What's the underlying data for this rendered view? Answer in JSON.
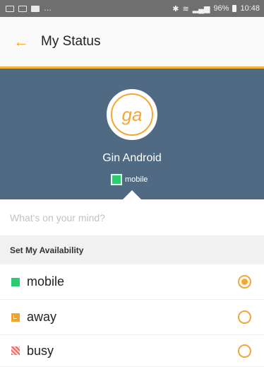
{
  "statusbar": {
    "right_text": "96%",
    "time": "10:48",
    "left_icons": [
      "image-icon",
      "message-icon",
      "notification-icon"
    ],
    "right_icons": [
      "bluetooth-icon",
      "wifi-icon",
      "signal-icon",
      "battery-icon"
    ]
  },
  "toolbar": {
    "back_icon": "arrow-left-icon",
    "title": "My Status"
  },
  "profile": {
    "initials": "ga",
    "name": "Gin Android",
    "status_label": "mobile"
  },
  "mind": {
    "placeholder": "What's on your mind?"
  },
  "availability": {
    "header": "Set My Availability",
    "options": [
      {
        "label": "mobile",
        "color": "#2ecc71",
        "selected": true
      },
      {
        "label": "away",
        "color": "#f1a32b",
        "selected": false
      },
      {
        "label": "busy",
        "color": "#f06a6a",
        "selected": false
      }
    ]
  },
  "colors": {
    "accent": "#f4a733",
    "header_bg": "#4f6a82",
    "status_bar": "#6f6f6f"
  }
}
